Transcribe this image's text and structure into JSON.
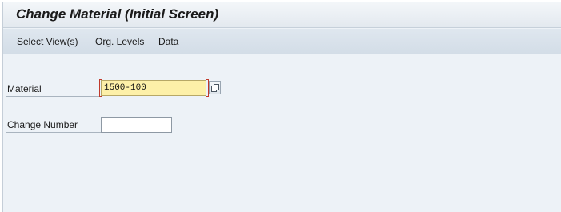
{
  "window": {
    "title": "Change Material (Initial Screen)"
  },
  "menu": {
    "items": [
      {
        "label": "Select View(s)"
      },
      {
        "label": "Org. Levels"
      },
      {
        "label": "Data"
      }
    ]
  },
  "form": {
    "material": {
      "label": "Material",
      "value": "1500-100",
      "required": true,
      "highlight_color": "#fdf0a8"
    },
    "change_number": {
      "label": "Change Number",
      "value": ""
    },
    "value_help_icon": "value-help-icon"
  }
}
